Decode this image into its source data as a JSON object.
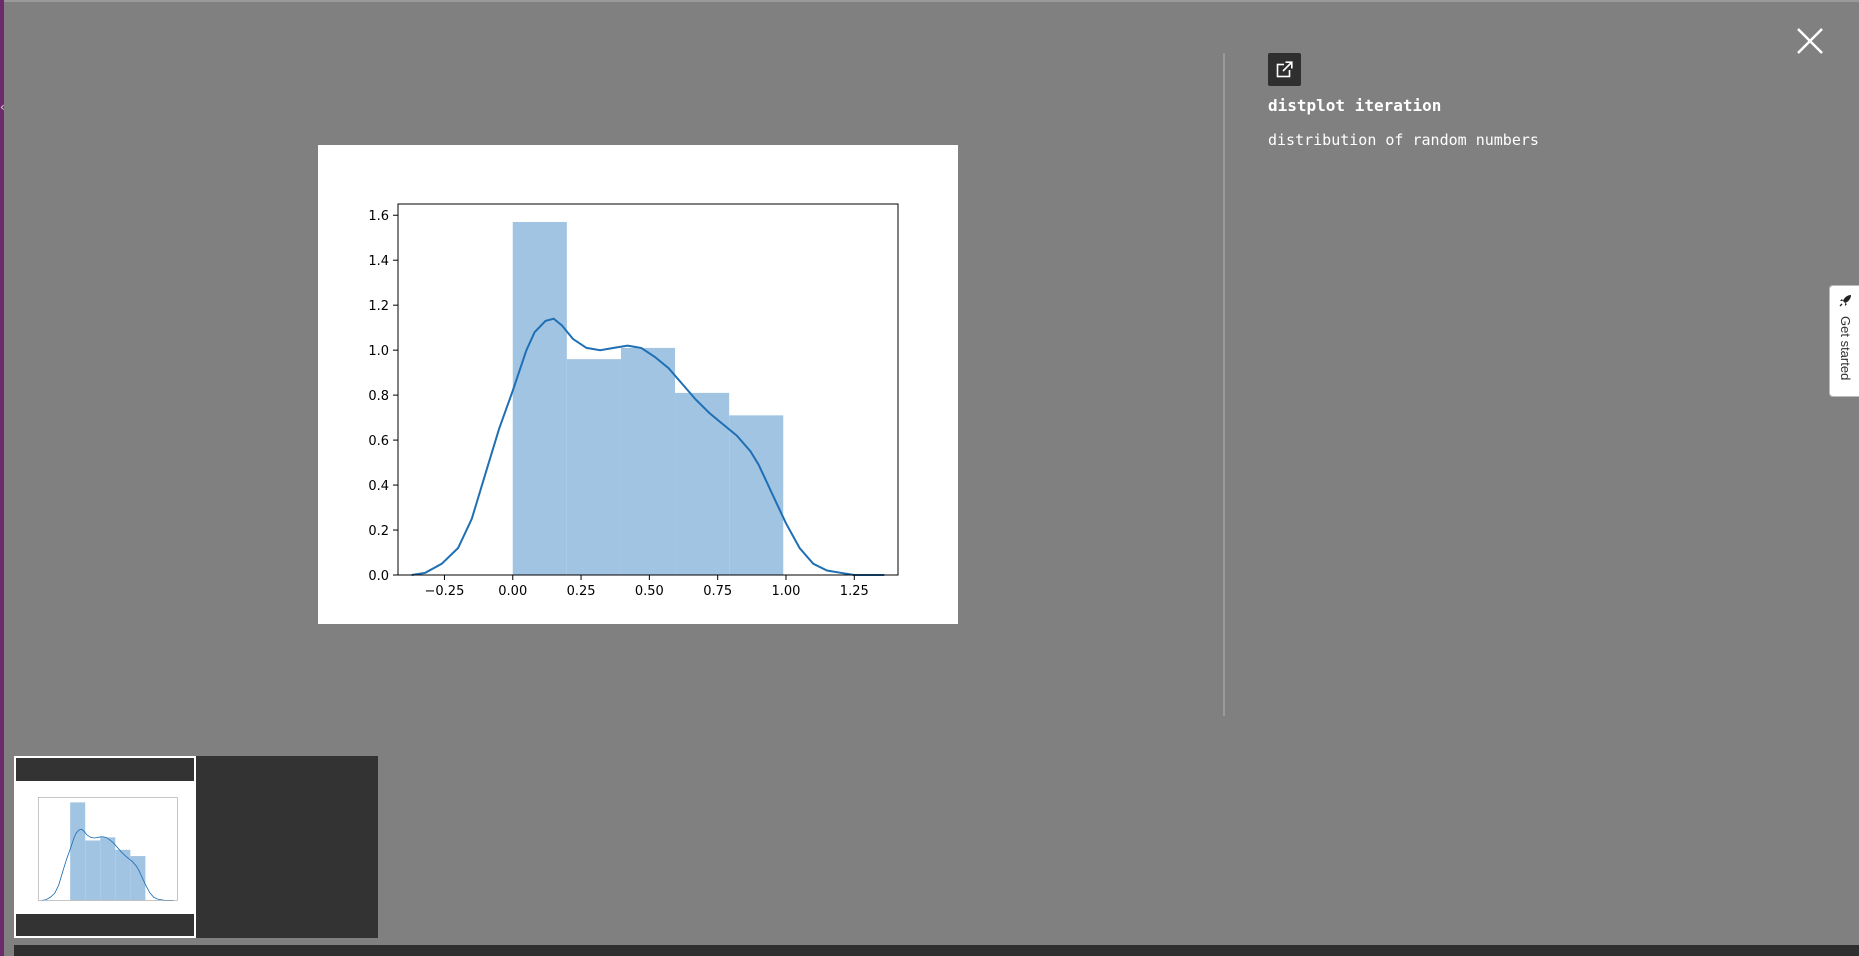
{
  "panel": {
    "title": "distplot iteration",
    "description": "distribution of random numbers"
  },
  "tab": {
    "label": "Get started"
  },
  "icons": {
    "close": "close-icon",
    "open_new": "external-link-icon",
    "rocket": "rocket-icon",
    "caret": "chevron-left-icon"
  },
  "colors": {
    "backdrop": "#808080",
    "bar_fill": "#a1c4e3",
    "kde_line": "#1f6fb4"
  },
  "chart_data": {
    "type": "bar",
    "bins": [
      {
        "x0": 0.0,
        "x1": 0.198,
        "density": 1.57
      },
      {
        "x0": 0.198,
        "x1": 0.396,
        "density": 0.96
      },
      {
        "x0": 0.396,
        "x1": 0.594,
        "density": 1.01
      },
      {
        "x0": 0.594,
        "x1": 0.792,
        "density": 0.81
      },
      {
        "x0": 0.792,
        "x1": 0.99,
        "density": 0.71
      }
    ],
    "kde": {
      "x": [
        -0.37,
        -0.32,
        -0.26,
        -0.2,
        -0.15,
        -0.1,
        -0.05,
        0.0,
        0.05,
        0.08,
        0.12,
        0.15,
        0.18,
        0.22,
        0.27,
        0.32,
        0.37,
        0.42,
        0.47,
        0.52,
        0.57,
        0.62,
        0.67,
        0.72,
        0.77,
        0.82,
        0.87,
        0.9,
        0.95,
        1.0,
        1.05,
        1.1,
        1.15,
        1.2,
        1.25,
        1.3,
        1.36
      ],
      "y": [
        0.0,
        0.01,
        0.05,
        0.12,
        0.25,
        0.45,
        0.65,
        0.82,
        1.0,
        1.08,
        1.13,
        1.14,
        1.11,
        1.05,
        1.01,
        1.0,
        1.01,
        1.02,
        1.01,
        0.97,
        0.92,
        0.85,
        0.78,
        0.72,
        0.67,
        0.62,
        0.55,
        0.49,
        0.36,
        0.23,
        0.12,
        0.05,
        0.02,
        0.01,
        0.0,
        0.0,
        0.0
      ]
    },
    "xlim": [
      -0.42,
      1.41
    ],
    "ylim": [
      0.0,
      1.65
    ],
    "x_ticks": [
      -0.25,
      0.0,
      0.25,
      0.5,
      0.75,
      1.0,
      1.25
    ],
    "x_tick_labels": [
      "−0.25",
      "0.00",
      "0.25",
      "0.50",
      "0.75",
      "1.00",
      "1.25"
    ],
    "y_ticks": [
      0.0,
      0.2,
      0.4,
      0.6,
      0.8,
      1.0,
      1.2,
      1.4,
      1.6
    ],
    "y_tick_labels": [
      "0.0",
      "0.2",
      "0.4",
      "0.6",
      "0.8",
      "1.0",
      "1.2",
      "1.4",
      "1.6"
    ],
    "title": "",
    "xlabel": "",
    "ylabel": "",
    "grid": false
  }
}
